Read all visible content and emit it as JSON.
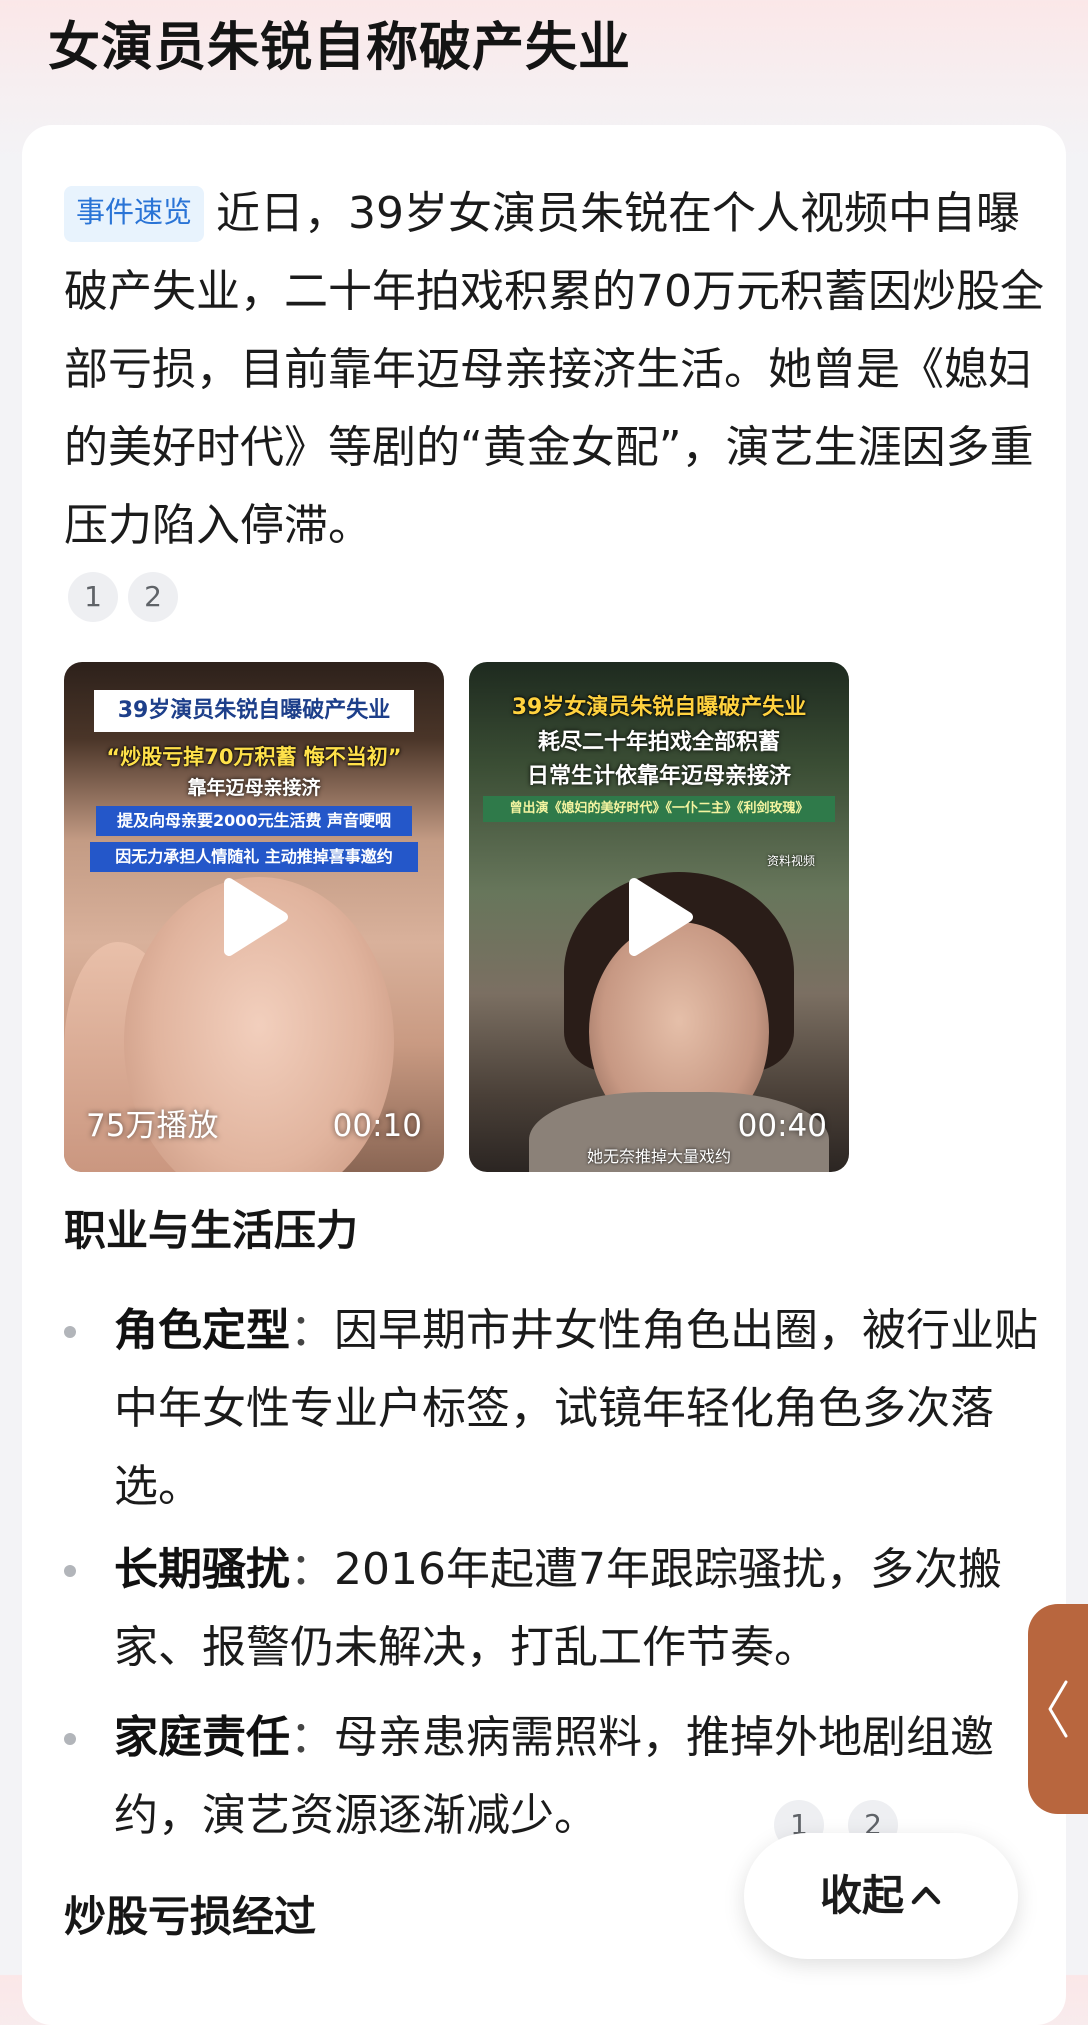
{
  "page": {
    "title": "女演员朱锐自称破产失业"
  },
  "summary": {
    "badge": "事件速览",
    "text": "近日，39岁女演员朱锐在个人视频中自曝破产失业，二十年拍戏积累的70万元积蓄因炒股全部亏损，目前靠年迈母亲接济生活。她曾是《媳妇的美好时代》等剧的“黄金女配”，演艺生涯因多重压力陷入停滞。",
    "refs": [
      "1",
      "2"
    ]
  },
  "videos": [
    {
      "caption_lines": [
        "39岁演员朱锐自曝破产失业",
        "“炒股亏掉70万积蓄 悔不当初”",
        "靠年迈母亲接济",
        "提及向母亲要2000元生活费 声音哽咽",
        "因无力承担人情随礼 主动推掉喜事邀约"
      ],
      "views": "75万播放",
      "duration": "00:10"
    },
    {
      "caption_lines": [
        "39岁女演员朱锐自曝破产失业",
        "耗尽二十年拍戏全部积蓄",
        "日常生计依靠年迈母亲接济",
        "曾出演《媳妇的美好时代》《一仆二主》《利剑玫瑰》"
      ],
      "source_tag": "资料视频",
      "subtitle": "她无奈推掉大量戏约",
      "views": "",
      "duration": "00:40"
    }
  ],
  "section1": {
    "title": "职业与生活压力",
    "bullets": [
      {
        "head": "角色定型",
        "colon": "：",
        "body": "因早期市井女性角色出圈，被行业贴中年女性专业户标签，试镜年轻化角色多次落选。"
      },
      {
        "head": "长期骚扰",
        "colon": "：",
        "body": "2016年起遭7年跟踪骚扰，多次搬家、报警仍未解决，打乱工作节奏。"
      },
      {
        "head": "家庭责任",
        "colon": "：",
        "body": "母亲患病需照料，推掉外地剧组邀约，演艺资源逐渐减少。"
      }
    ],
    "refs": [
      "1",
      "2"
    ]
  },
  "section2": {
    "title": "炒股亏损经过"
  },
  "controls": {
    "collapse_label": "收起"
  },
  "colors": {
    "badge_bg": "#e8f3fd",
    "badge_text": "#2a74d6",
    "side_tab": "#b8663e"
  },
  "icons": {
    "play": "play-icon",
    "collapse": "chevron-up-icon",
    "side_tab": "chevron-left-icon"
  }
}
